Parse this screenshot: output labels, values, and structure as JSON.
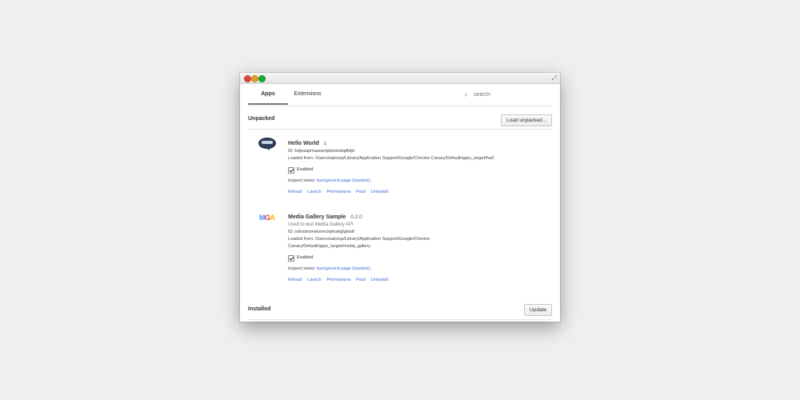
{
  "tabs": {
    "apps": "Apps",
    "extensions": "Extensions"
  },
  "search": {
    "placeholder": "search"
  },
  "unpacked": {
    "title": "Unpacked",
    "load_button": "Load unpacked..."
  },
  "apps": [
    {
      "name": "Hello World",
      "version": "1",
      "description": "",
      "id": "ID: bdjeaapmaaoenipkeeiobipfldjd",
      "loaded_from": "Loaded from: /Users/sairoop/Library/Application Support/Google/Chrome Canary/Default/apps_target/hw2",
      "enabled_label": "Enabled",
      "inspect_label": "Inspect views:",
      "inspect_link": "background page (Inactive)",
      "actions": [
        "Reload",
        "Launch",
        "Permissions",
        "Pack",
        "Uninstall"
      ],
      "icon": "chat-bubble-icon"
    },
    {
      "name": "Media Gallery Sample",
      "version": "0.2.0",
      "description": "Used to test Media Gallery API",
      "id": "ID: ednsbromekemchjkhakgfgloidf",
      "loaded_from": "Loaded from: /Users/sairoop/Library/Application Support/Google/Chrome Canary/Default/apps_target/media_gallery",
      "enabled_label": "Enabled",
      "inspect_label": "Inspect views:",
      "inspect_link": "background page (Inactive)",
      "actions": [
        "Reload",
        "Launch",
        "Permissions",
        "Pack",
        "Uninstall"
      ],
      "icon_text": "MGA"
    }
  ],
  "installed": {
    "title": "Installed",
    "update_button": "Update"
  },
  "colors": {
    "link": "#3b6cd6",
    "close": "#e0443e",
    "minimize": "#dea123",
    "maximize": "#1aab29"
  }
}
